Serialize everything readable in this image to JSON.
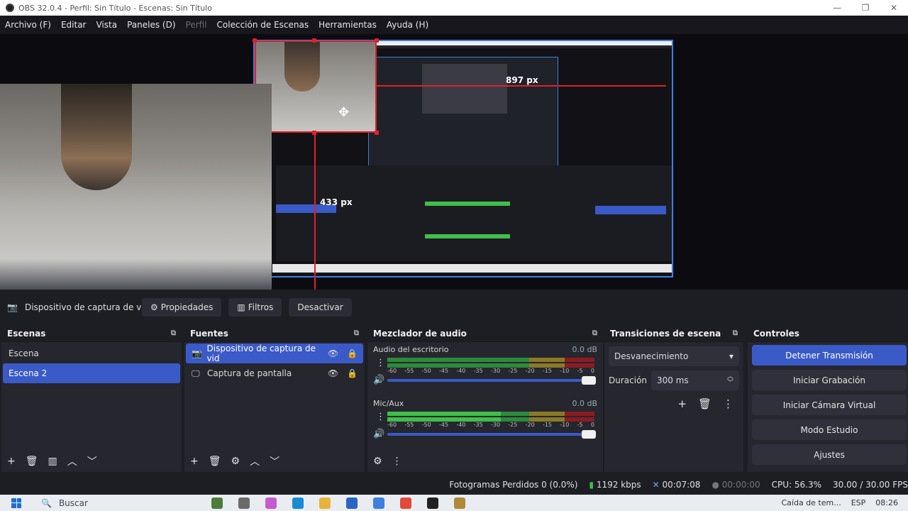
{
  "window": {
    "title": "OBS 32.0.4 - Perfil: Sin Título - Escenas: Sin Título",
    "controls": [
      "—",
      "❐",
      "✕"
    ]
  },
  "menu": [
    {
      "label": "Archivo (F)",
      "disabled": false
    },
    {
      "label": "Editar",
      "disabled": false
    },
    {
      "label": "Vista",
      "disabled": false
    },
    {
      "label": "Paneles (D)",
      "disabled": false
    },
    {
      "label": "Perfil",
      "disabled": true
    },
    {
      "label": "Colección de Escenas",
      "disabled": false
    },
    {
      "label": "Herramientas",
      "disabled": false
    },
    {
      "label": "Ayuda (H)",
      "disabled": false
    }
  ],
  "preview": {
    "width_label": "897 px",
    "height_label": "433 px"
  },
  "source_toolbar": {
    "source_name": "Dispositivo de captura de v",
    "properties": "Propiedades",
    "filters": "Filtros",
    "deactivate": "Desactivar"
  },
  "scenes": {
    "title": "Escenas",
    "items": [
      "Escena",
      "Escena 2"
    ],
    "selected_index": 1
  },
  "sources": {
    "title": "Fuentes",
    "items": [
      {
        "label": "Dispositivo de captura de vid",
        "icon": "camera-icon"
      },
      {
        "label": "Captura de pantalla",
        "icon": "monitor-icon"
      }
    ],
    "selected_index": 0
  },
  "mixer": {
    "title": "Mezclador de audio",
    "channels": [
      {
        "name": "Audio del escritorio",
        "db": "0.0 dB"
      },
      {
        "name": "Mic/Aux",
        "db": "0.0 dB"
      }
    ],
    "scale": [
      "-60",
      "-55",
      "-50",
      "-45",
      "-40",
      "-35",
      "-30",
      "-25",
      "-20",
      "-15",
      "-10",
      "-5",
      "0"
    ]
  },
  "transitions": {
    "title": "Transiciones de escena",
    "selected": "Desvanecimiento",
    "duration_label": "Duración",
    "duration_value": "300 ms"
  },
  "controls": {
    "title": "Controles",
    "stop_stream": "Detener Transmisión",
    "start_record": "Iniciar Grabación",
    "virtual_cam": "Iniciar Cámara Virtual",
    "studio_mode": "Modo Estudio",
    "settings": "Ajustes"
  },
  "status": {
    "dropped_frames": "Fotogramas Perdidos 0 (0.0%)",
    "bitrate": "1192 kbps",
    "stream_time": "00:07:08",
    "record_time": "00:00:00",
    "cpu": "CPU: 56.3%",
    "fps": "30.00 / 30.00 FPS"
  },
  "taskbar": {
    "search": "Buscar",
    "tray_text": "Caída de tem...",
    "lang": "ESP",
    "time": "08:26"
  },
  "colors": {
    "accent": "#3a5ac8",
    "selection_red": "#e0202a",
    "canvas_border": "#3f7fe0",
    "meter_green": "#3fbf4a",
    "meter_yellow": "#c7a12a",
    "meter_red": "#b8222a"
  }
}
